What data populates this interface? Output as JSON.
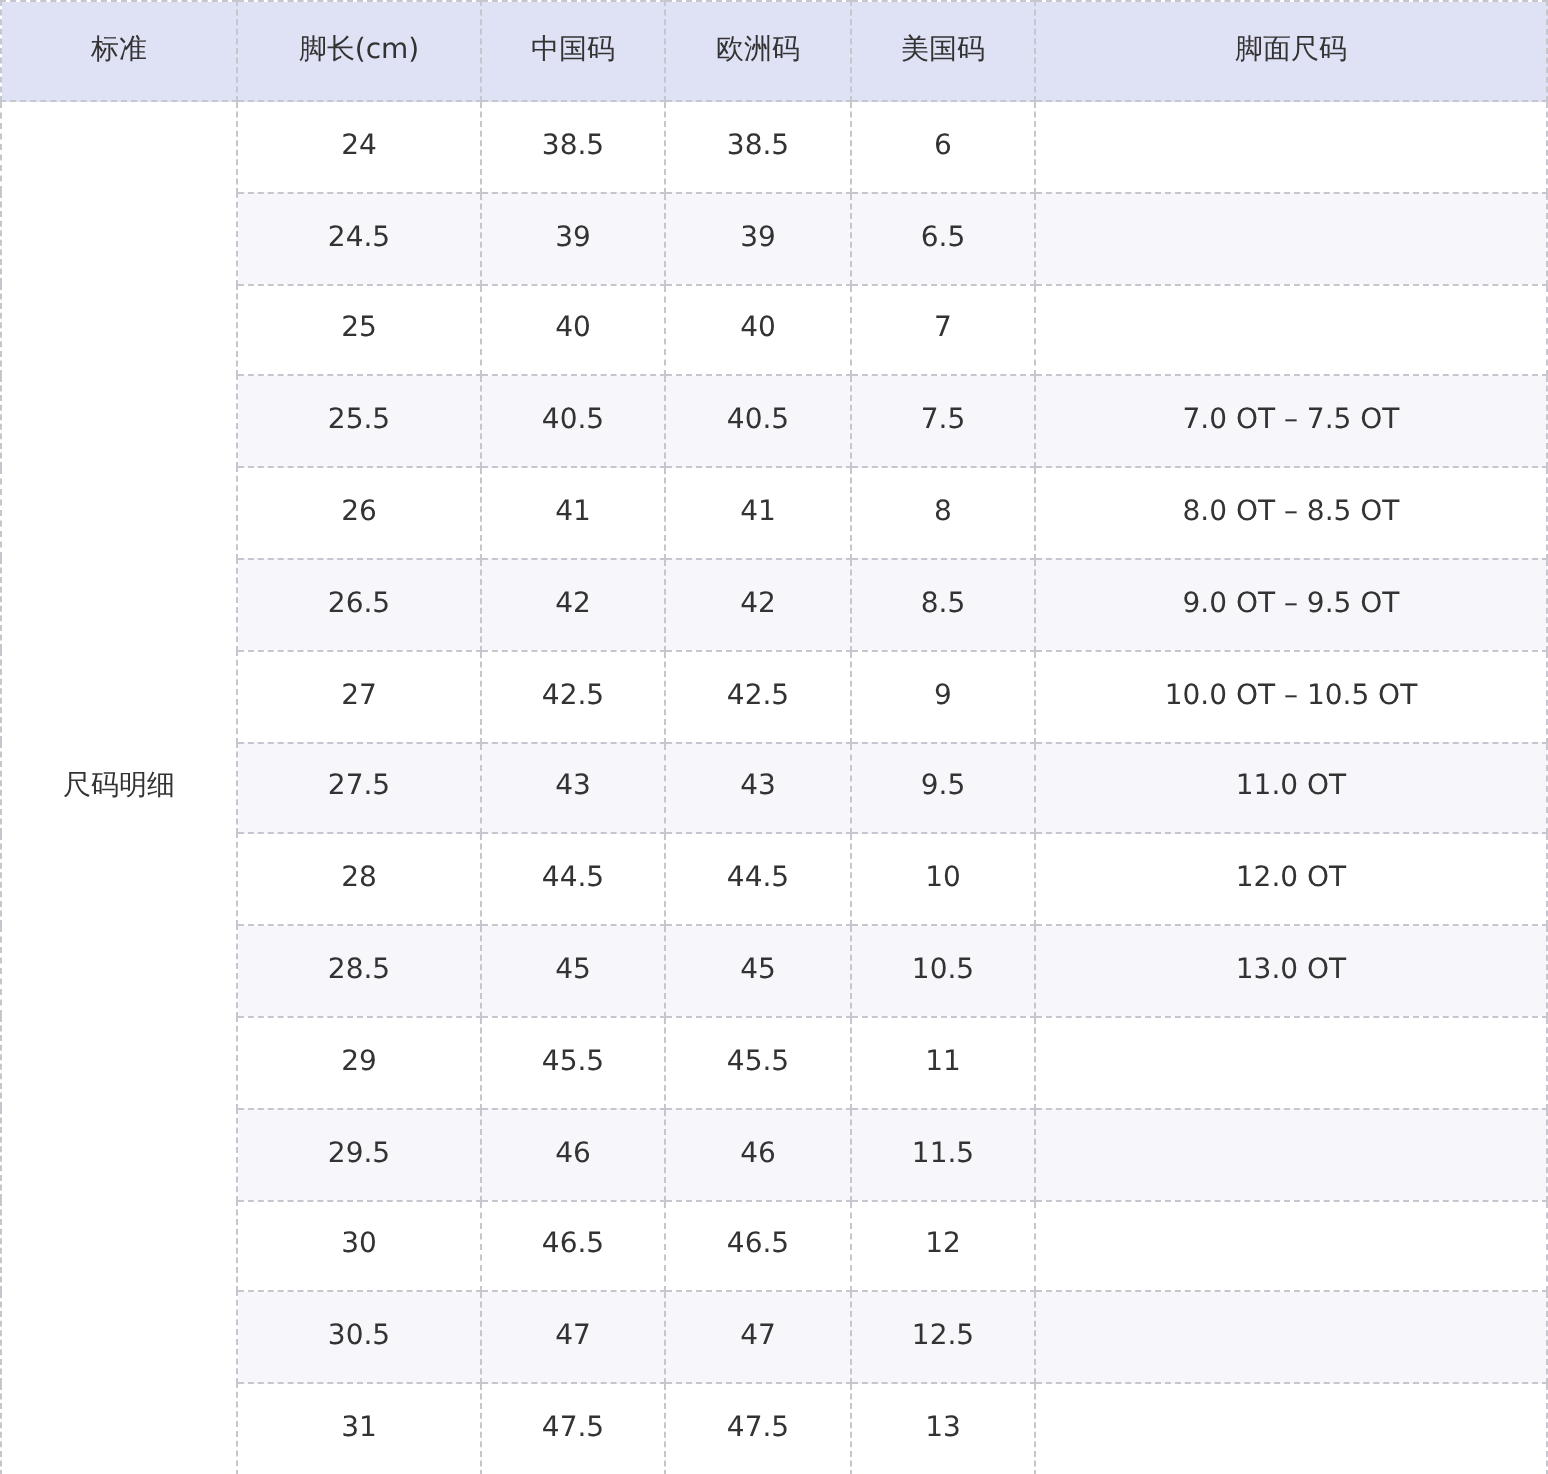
{
  "table": {
    "columns": [
      "标准",
      "脚长(cm)",
      "中国码",
      "欧洲码",
      "美国码",
      "脚面尺码"
    ],
    "group_label": "尺码明细",
    "rows": [
      {
        "foot_length": "24",
        "cn": "38.5",
        "eu": "38.5",
        "us": "6"
      },
      {
        "foot_length": "24.5",
        "cn": "39",
        "eu": "39",
        "us": "6.5"
      },
      {
        "foot_length": "25",
        "cn": "40",
        "eu": "40",
        "us": "7"
      },
      {
        "foot_length": "25.5",
        "cn": "40.5",
        "eu": "40.5",
        "us": "7.5",
        "width": "7.0 OT – 7.5 OT"
      },
      {
        "foot_length": "26",
        "cn": "41",
        "eu": "41",
        "us": "8",
        "width": "8.0 OT – 8.5 OT"
      },
      {
        "foot_length": "26.5",
        "cn": "42",
        "eu": "42",
        "us": "8.5",
        "width": "9.0 OT – 9.5 OT"
      },
      {
        "foot_length": "27",
        "cn": "42.5",
        "eu": "42.5",
        "us": "9",
        "width": "10.0 OT – 10.5 OT"
      },
      {
        "foot_length": "27.5",
        "cn": "43",
        "eu": "43",
        "us": "9.5",
        "width": "11.0 OT"
      },
      {
        "foot_length": "28",
        "cn": "44.5",
        "eu": "44.5",
        "us": "10",
        "width": "12.0 OT"
      },
      {
        "foot_length": "28.5",
        "cn": "45",
        "eu": "45",
        "us": "10.5",
        "width": "13.0 OT"
      },
      {
        "foot_length": "29",
        "cn": "45.5",
        "eu": "45.5",
        "us": "11"
      },
      {
        "foot_length": "29.5",
        "cn": "46",
        "eu": "46",
        "us": "11.5"
      },
      {
        "foot_length": "30",
        "cn": "46.5",
        "eu": "46.5",
        "us": "12"
      },
      {
        "foot_length": "30.5",
        "cn": "47",
        "eu": "47",
        "us": "12.5"
      },
      {
        "foot_length": "31",
        "cn": "47.5",
        "eu": "47.5",
        "us": "13"
      }
    ]
  }
}
